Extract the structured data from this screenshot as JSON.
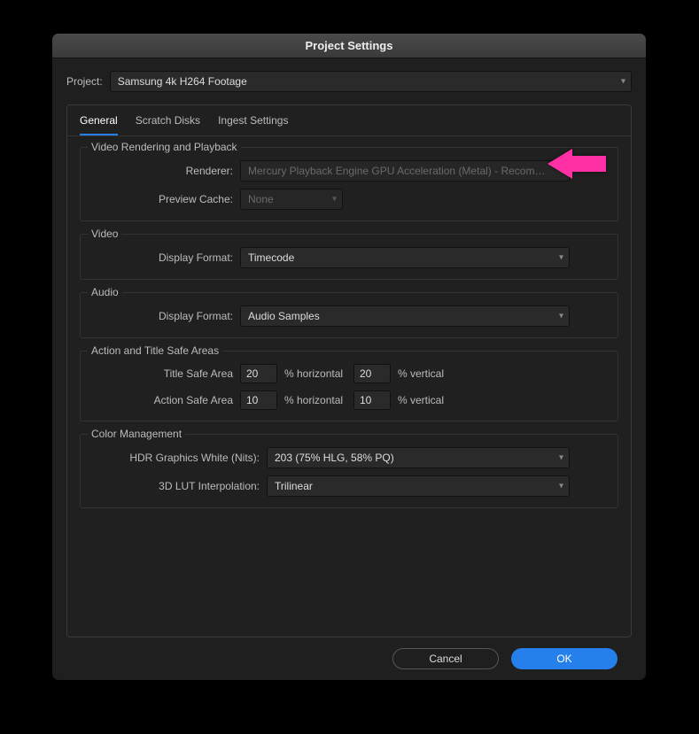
{
  "window": {
    "title": "Project Settings"
  },
  "project": {
    "label": "Project:",
    "value": "Samsung 4k H264 Footage"
  },
  "tabs": [
    {
      "id": "general",
      "label": "General",
      "active": true
    },
    {
      "id": "scratch",
      "label": "Scratch Disks",
      "active": false
    },
    {
      "id": "ingest",
      "label": "Ingest Settings",
      "active": false
    }
  ],
  "groups": {
    "render": {
      "legend": "Video Rendering and Playback",
      "renderer": {
        "label": "Renderer:",
        "value": "Mercury Playback Engine GPU Acceleration (Metal) - Recommended"
      },
      "preview": {
        "label": "Preview Cache:",
        "value": "None"
      }
    },
    "video": {
      "legend": "Video",
      "format": {
        "label": "Display Format:",
        "value": "Timecode"
      }
    },
    "audio": {
      "legend": "Audio",
      "format": {
        "label": "Display Format:",
        "value": "Audio Samples"
      }
    },
    "safe": {
      "legend": "Action and Title Safe Areas",
      "title": {
        "label": "Title Safe Area",
        "h": "20",
        "v": "20",
        "hunit": "% horizontal",
        "vunit": "% vertical"
      },
      "action": {
        "label": "Action Safe Area",
        "h": "10",
        "v": "10",
        "hunit": "% horizontal",
        "vunit": "% vertical"
      }
    },
    "color": {
      "legend": "Color Management",
      "hdr": {
        "label": "HDR Graphics White (Nits):",
        "value": "203 (75% HLG, 58% PQ)"
      },
      "lut": {
        "label": "3D LUT Interpolation:",
        "value": "Trilinear"
      }
    }
  },
  "buttons": {
    "cancel": "Cancel",
    "ok": "OK"
  },
  "annotation": {
    "arrow_color": "#ff2fa4"
  }
}
